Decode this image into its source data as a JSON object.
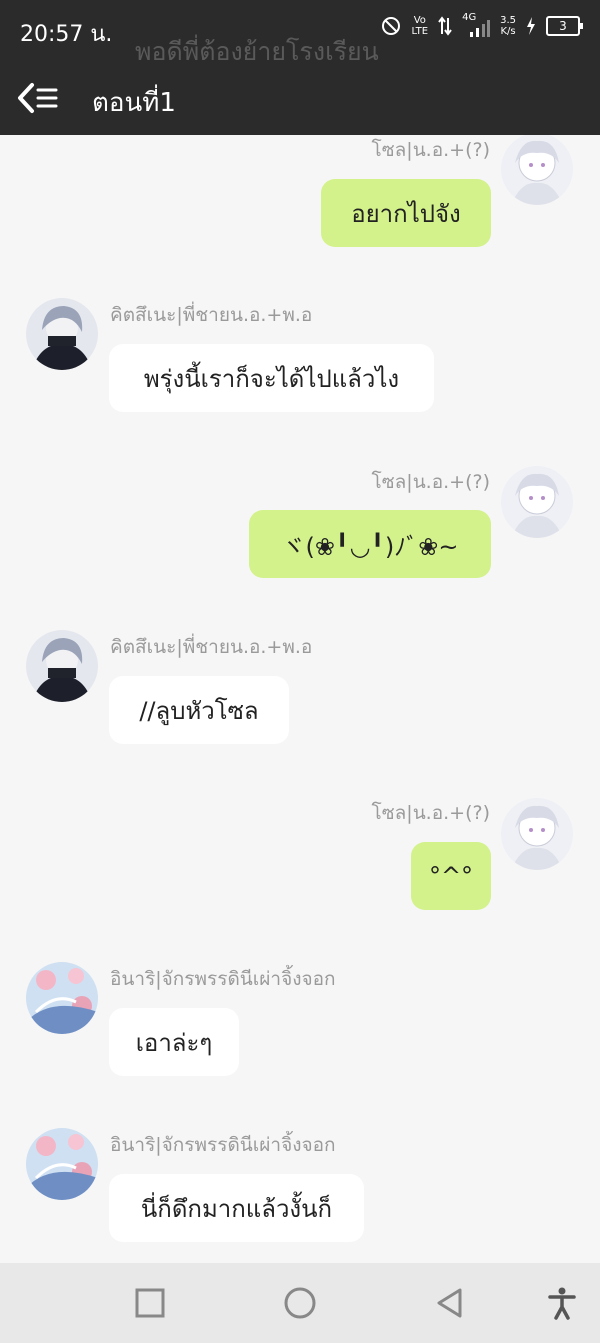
{
  "status_bar": {
    "time": "20:57 น.",
    "network_top": "Vo",
    "network_bottom": "LTE",
    "signal_label": "4G",
    "speed_value": "3.5",
    "speed_unit": "K/s",
    "battery": "3"
  },
  "header": {
    "title": "ตอนที่1",
    "ghost_text": "พอดีพี่ต้องย้ายโรงเรียน"
  },
  "messages": [
    {
      "side": "right",
      "name": "โซล|น.อ.+(?)",
      "text": "อยากไปจัง",
      "avatar": "white-hair-avatar"
    },
    {
      "side": "left",
      "name": "คิตสึเนะ|พี่ชายน.อ.+พ.อ",
      "text": "พรุ่งนี้เราก็จะได้ไปแล้วไง",
      "avatar": "grey-hair-avatar"
    },
    {
      "side": "right",
      "name": "โซล|น.อ.+(?)",
      "text": "ヾ(❀╹◡╹)ﾉﾞ❀~",
      "avatar": "white-hair-avatar"
    },
    {
      "side": "left",
      "name": "คิตสึเนะ|พี่ชายน.อ.+พ.อ",
      "text": "//ลูบหัวโซล",
      "avatar": "grey-hair-avatar"
    },
    {
      "side": "right",
      "name": "โซล|น.อ.+(?)",
      "text": "°^°",
      "avatar": "white-hair-avatar"
    },
    {
      "side": "left",
      "name": "อินาริ|จักรพรรดินีเผ่าจิ้งจอก",
      "text": "เอาล่ะๆ",
      "avatar": "sakura-avatar"
    },
    {
      "side": "left",
      "name": "อินาริ|จักรพรรดินีเผ่าจิ้งจอก",
      "text": "นี่ก็ดึกมากแล้วงั้นก็",
      "avatar": "sakura-avatar"
    }
  ],
  "colors": {
    "header_bg": "#2b2b2b",
    "chat_bg": "#f6f6f6",
    "own_bubble": "#d3f28b",
    "other_bubble": "#ffffff",
    "name_text": "#9a9a9a"
  }
}
